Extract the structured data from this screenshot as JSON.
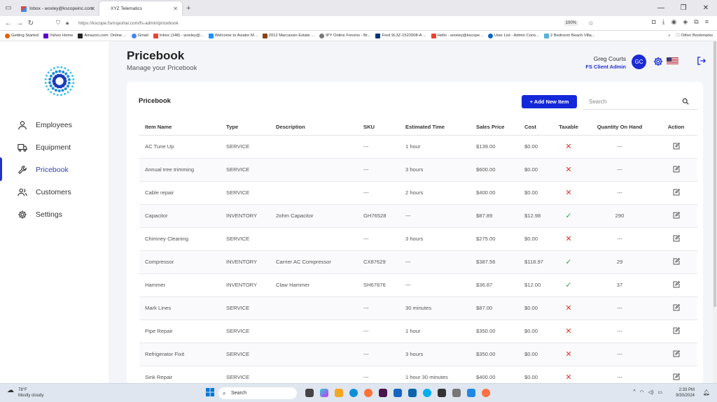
{
  "browser": {
    "tabs": [
      {
        "label": "Inbox - woxley@kscopeinc.com",
        "icon": "gmail-icon",
        "active": false
      },
      {
        "label": "XYZ Telematics",
        "icon": "site-icon",
        "active": true
      }
    ],
    "url": "https://kscope.fsmsportal.com/fs-admin/pricebook",
    "zoom": "100%",
    "bookmarks": [
      "Getting Started",
      "Yahoo Home",
      "Amazon.com: Online ...",
      "Gmail",
      "Inbox (148) - woxley@...",
      "Welcome to Aviator M...",
      "2012 Marcassin Estate ...",
      "IPY Online Forums - Br...",
      "Ford 9L3Z-1522008-A ...",
      "Hello - woxley@kscope...",
      "User List - Admin Cons...",
      "2 Bedroom Beach Villa..."
    ],
    "other_bookmarks": "Other Bookmarks"
  },
  "sidebar": {
    "items": [
      {
        "label": "Employees",
        "icon": "person-icon"
      },
      {
        "label": "Equipment",
        "icon": "truck-icon"
      },
      {
        "label": "Pricebook",
        "icon": "wrench-icon",
        "active": true
      },
      {
        "label": "Customers",
        "icon": "people-icon"
      },
      {
        "label": "Settings",
        "icon": "gear-icon"
      }
    ]
  },
  "header": {
    "title": "Pricebook",
    "subtitle": "Manage your Pricebook",
    "user_name": "Greg Courts",
    "user_role": "FS Client Admin",
    "avatar_initials": "GC"
  },
  "card": {
    "title": "Pricebook",
    "add_button": "+ Add New Item",
    "search_placeholder": "Search",
    "columns": [
      "Item Name",
      "Type",
      "Description",
      "SKU",
      "Estimated Time",
      "Sales Price",
      "Cost",
      "Taxable",
      "Quantity On Hand",
      "Action"
    ],
    "rows": [
      {
        "name": "AC Tune Up",
        "type": "SERVICE",
        "desc": "",
        "sku": "---",
        "time": "1 hour",
        "price": "$139.00",
        "cost": "$0.00",
        "taxable": false,
        "qty": "---"
      },
      {
        "name": "Annual tree trimming",
        "type": "SERVICE",
        "desc": "",
        "sku": "---",
        "time": "3 hours",
        "price": "$600.00",
        "cost": "$0.00",
        "taxable": false,
        "qty": "---"
      },
      {
        "name": "Cable repair",
        "type": "SERVICE",
        "desc": "",
        "sku": "---",
        "time": "2 hours",
        "price": "$400.00",
        "cost": "$0.00",
        "taxable": false,
        "qty": "---"
      },
      {
        "name": "Capacitor",
        "type": "INVENTORY",
        "desc": "2ohm Capacitor",
        "sku": "GH76528",
        "time": "---",
        "price": "$87.89",
        "cost": "$12.98",
        "taxable": true,
        "qty": "290"
      },
      {
        "name": "Chimney Cleaning",
        "type": "SERVICE",
        "desc": "",
        "sku": "---",
        "time": "3 hours",
        "price": "$275.00",
        "cost": "$0.00",
        "taxable": false,
        "qty": "---"
      },
      {
        "name": "Compressor",
        "type": "INVENTORY",
        "desc": "Carrier AC Compressor",
        "sku": "CX87629",
        "time": "---",
        "price": "$387.56",
        "cost": "$118.97",
        "taxable": true,
        "qty": "29"
      },
      {
        "name": "Hammer",
        "type": "INVENTORY",
        "desc": "Claw Hammer",
        "sku": "SH67876",
        "time": "---",
        "price": "$36.87",
        "cost": "$12.00",
        "taxable": true,
        "qty": "37"
      },
      {
        "name": "Mark Lines",
        "type": "SERVICE",
        "desc": "",
        "sku": "---",
        "time": "30 minutes",
        "price": "$87.00",
        "cost": "$0.00",
        "taxable": false,
        "qty": "---"
      },
      {
        "name": "Pipe Repair",
        "type": "SERVICE",
        "desc": "",
        "sku": "---",
        "time": "1 hour",
        "price": "$350.00",
        "cost": "$0.00",
        "taxable": false,
        "qty": "---"
      },
      {
        "name": "Refrigerator Fixit",
        "type": "SERVICE",
        "desc": "",
        "sku": "---",
        "time": "3 hours",
        "price": "$350.00",
        "cost": "$0.00",
        "taxable": false,
        "qty": "---"
      },
      {
        "name": "Sink Repair",
        "type": "SERVICE",
        "desc": "",
        "sku": "---",
        "time": "1 hour 30 minutes",
        "price": "$400.00",
        "cost": "$0.00",
        "taxable": false,
        "qty": "---"
      }
    ]
  },
  "taskbar": {
    "temp": "78°F",
    "weather": "Mostly cloudy",
    "search": "Search",
    "time": "2:33 PM",
    "date": "9/30/2024"
  },
  "colors": {
    "accent": "#1428d9",
    "taxable_no": "#d9362b",
    "taxable_yes": "#2da54d"
  }
}
